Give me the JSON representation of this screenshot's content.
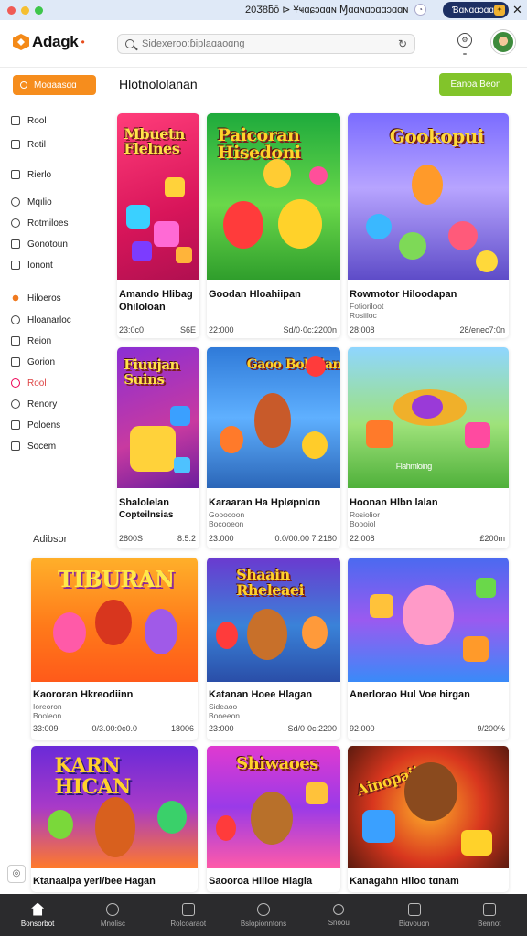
{
  "os_bar": {
    "status_text": "20Ӡ8ƃō ⊳ Ұҹɑɕɔɑɑɴ Ɱɑɑɴɑɔɑɑɔɑɑɴ",
    "pill_label": "Ɓɑɴɑɑɔɑɑ",
    "colors": {
      "red": "#f05b55",
      "yellow": "#f5bf32",
      "green": "#3ec64b"
    }
  },
  "header": {
    "logo_text": "Adagk",
    "search_placeholder": "Sidexeroo:ɓiplaɑaoɑng",
    "avatar_name": "user-avatar"
  },
  "sidebar": {
    "primary_button": "Moɑaasɑɑ",
    "items": [
      {
        "label": "Rool",
        "icon": "home-icon"
      },
      {
        "label": "Rotil",
        "icon": "list-icon"
      },
      {
        "label": "Rierlo",
        "icon": "grid-icon"
      },
      {
        "label": "Mqılio",
        "icon": "user-icon"
      },
      {
        "label": "Rotmiloes",
        "icon": "cloud-icon"
      },
      {
        "label": "Gonotoun",
        "icon": "chart-icon"
      },
      {
        "label": "Ionont",
        "icon": "box-icon"
      },
      {
        "label": "Hiloeros",
        "icon": "star-icon"
      },
      {
        "label": "Hloanarloc",
        "icon": "circle-icon"
      },
      {
        "label": "Reion",
        "icon": "square-icon"
      },
      {
        "label": "Gorion",
        "icon": "square-icon"
      },
      {
        "label": "Rool",
        "icon": "alert-icon"
      },
      {
        "label": "Renory",
        "icon": "user-icon"
      },
      {
        "label": "Poloens",
        "icon": "list-icon"
      },
      {
        "label": "Socem",
        "icon": "box-icon"
      }
    ]
  },
  "main": {
    "title": "Hlotnololanan",
    "action_button": "Eanoa Beon",
    "section_label": "Adibsor"
  },
  "cards": [
    {
      "art": "Mbuetn Flelnes",
      "title": "Amando Hlibag",
      "sub": "Ohiloloan",
      "meta": [
        "23:0c0",
        "",
        "S6E"
      ]
    },
    {
      "art": "Paicoran Hisedoni",
      "title": "Goodan Hloahiipan",
      "sub": "",
      "meta": [
        "22:000",
        "",
        "Sd/0·0c:2200n"
      ]
    },
    {
      "art": "Gookopui",
      "title": "Rowmotor Hiloodapan",
      "sub": "Fotioriloot",
      "sub2": "Rosiiloc",
      "meta": [
        "28:008",
        "",
        "28/enec7:0n"
      ]
    },
    {
      "art": "Fiuujan Suins",
      "title": "Shalolelan",
      "sub": "Copteilnsias",
      "meta": [
        "2800S",
        "",
        "8:5.2"
      ]
    },
    {
      "art": "Gaoo Bolodan",
      "title": "Karaaran Ha Hpløpnlɑn",
      "sub": "Gooocoon",
      "sub2": "Bocooeon",
      "meta": [
        "23.000",
        "",
        "0:0/00:00 7:2180"
      ]
    },
    {
      "art": "Flahmloing",
      "title": "Hoonan Hlbn lalan",
      "sub": "Rosiolior",
      "sub2": "Boooiol",
      "meta": [
        "22.008",
        "",
        "£200m"
      ]
    },
    {
      "art": "TIBURAN",
      "title": "Kaororan Hkreodiinn",
      "sub": "Ioreoron",
      "sub2": "Booleon",
      "meta": [
        "33:009",
        "0/3.00:0c0.0",
        "18006"
      ]
    },
    {
      "art": "Shaain Rheleaei",
      "title": "Katanan Hoee Hlagan",
      "sub": "Sideaoo",
      "sub2": "Booeeon",
      "meta": [
        "23:000",
        "",
        "Sd/0·0c:2200"
      ]
    },
    {
      "art": "",
      "title": "Anerlorao Hul Voe hirgan",
      "sub": "",
      "meta": [
        "92.000",
        "",
        "9/200%"
      ]
    },
    {
      "art": "KARN HICAN",
      "title": "Ktanaalpa yerl/bee Hagan",
      "sub": "",
      "meta": []
    },
    {
      "art": "Shiwaoes",
      "title": "Saooroa Hilloe Hlagia",
      "sub": "",
      "meta": []
    },
    {
      "art": "Ainopaiiv",
      "title": "Kanagahn Hlioo tɑnam",
      "sub": "",
      "meta": []
    }
  ],
  "bottom_nav": [
    {
      "label": "Bonsorbot",
      "icon": "home-icon",
      "active": true
    },
    {
      "label": "Mnolisc",
      "icon": "compass-icon"
    },
    {
      "label": "Rolcoaraot",
      "icon": "box-icon"
    },
    {
      "label": "Bslopionntons",
      "icon": "circle-icon"
    },
    {
      "label": "Snoou",
      "icon": "search-icon"
    },
    {
      "label": "Biɑvouon",
      "icon": "grid-icon"
    },
    {
      "label": "Bennot",
      "icon": "box-icon"
    }
  ]
}
